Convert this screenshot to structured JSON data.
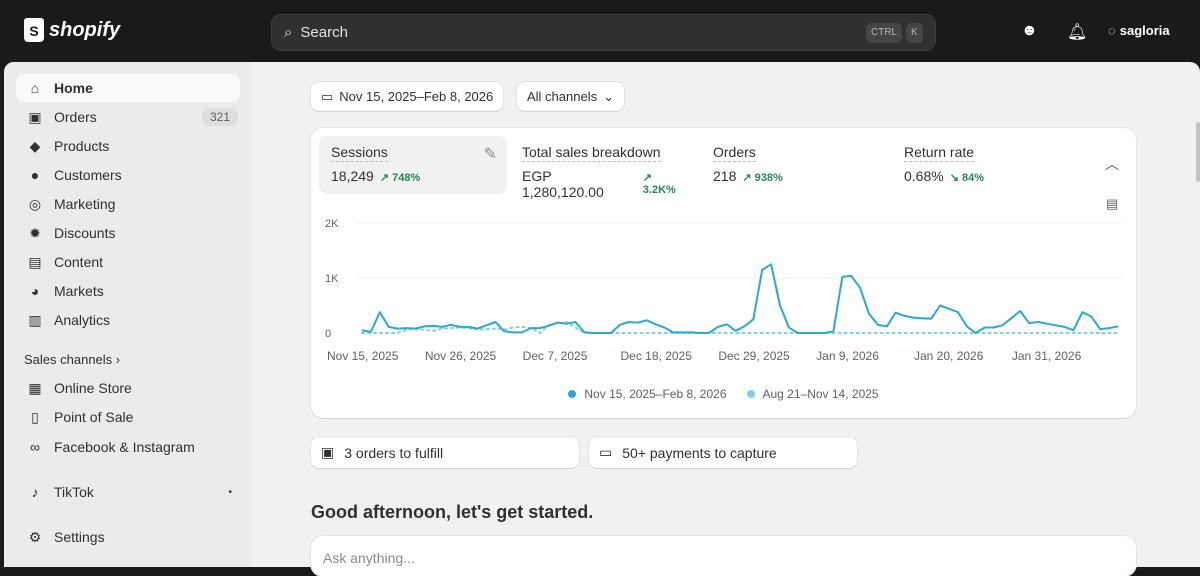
{
  "header": {
    "brand": "shopify",
    "search_placeholder": "Search",
    "kbd": [
      "CTRL",
      "K"
    ],
    "user": "sagloria"
  },
  "sidebar": {
    "items": [
      {
        "label": "Home",
        "icon": "home-icon",
        "glyph": "⌂"
      },
      {
        "label": "Orders",
        "icon": "inbox-icon",
        "glyph": "▣",
        "badge": "321"
      },
      {
        "label": "Products",
        "icon": "tag-icon",
        "glyph": "◆"
      },
      {
        "label": "Customers",
        "icon": "person-icon",
        "glyph": "●"
      },
      {
        "label": "Marketing",
        "icon": "target-icon",
        "glyph": "◎"
      },
      {
        "label": "Discounts",
        "icon": "discount-icon",
        "glyph": "✹"
      },
      {
        "label": "Content",
        "icon": "content-icon",
        "glyph": "▤"
      },
      {
        "label": "Markets",
        "icon": "globe-icon",
        "glyph": "◕"
      },
      {
        "label": "Analytics",
        "icon": "bar-chart-icon",
        "glyph": "▥"
      }
    ],
    "sales_channels_label": "Sales channels",
    "channels": [
      {
        "label": "Online Store",
        "icon": "store-icon",
        "glyph": "▦"
      },
      {
        "label": "Point of Sale",
        "icon": "pos-icon",
        "glyph": "▯"
      },
      {
        "label": "Facebook & Instagram",
        "icon": "meta-icon",
        "glyph": "∞"
      },
      {
        "label": "TikTok",
        "icon": "tiktok-icon",
        "glyph": "♪"
      }
    ],
    "settings_label": "Settings"
  },
  "filters": {
    "date_range": "Nov 15, 2025–Feb 8, 2026",
    "channel": "All channels"
  },
  "metrics": [
    {
      "label": "Sessions",
      "value": "18,249",
      "delta": "↗ 748%"
    },
    {
      "label": "Total sales breakdown",
      "value": "EGP 1,280,120.00",
      "delta": "↗ 3.2K%"
    },
    {
      "label": "Orders",
      "value": "218",
      "delta": "↗ 938%"
    },
    {
      "label": "Return rate",
      "value": "0.68%",
      "delta": "↘ 84%"
    }
  ],
  "chart_data": {
    "type": "line",
    "ylabels": [
      "0",
      "1K",
      "2K"
    ],
    "ylim": [
      0,
      2000
    ],
    "xlabels": [
      "Nov 15, 2025",
      "Nov 26, 2025",
      "Dec 7, 2025",
      "Dec 18, 2025",
      "Dec 29, 2025",
      "Jan 9, 2026",
      "Jan 20, 2026",
      "Jan 31, 2026"
    ],
    "series": [
      {
        "name": "Nov 15, 2025–Feb 8, 2026",
        "color": "#2ea7d4",
        "values": [
          50,
          20,
          380,
          110,
          80,
          90,
          80,
          120,
          130,
          110,
          150,
          110,
          110,
          80,
          140,
          200,
          30,
          10,
          10,
          90,
          90,
          130,
          190,
          170,
          200,
          10,
          0,
          0,
          0,
          150,
          200,
          190,
          230,
          160,
          100,
          10,
          10,
          10,
          0,
          0,
          110,
          160,
          40,
          120,
          250,
          1150,
          1250,
          500,
          100,
          0,
          0,
          0,
          0,
          30,
          1020,
          1040,
          820,
          350,
          150,
          120,
          370,
          310,
          280,
          270,
          260,
          500,
          440,
          380,
          120,
          0,
          100,
          100,
          140,
          270,
          400,
          180,
          200,
          170,
          140,
          110,
          50,
          380,
          300,
          70,
          90,
          120
        ]
      },
      {
        "name": "Aug 21–Nov 14, 2025",
        "color": "#7fcde6",
        "values": [
          0,
          0,
          0,
          0,
          0,
          60,
          70,
          60,
          40,
          80,
          90,
          100,
          90,
          60,
          70,
          80,
          60,
          100,
          110,
          90,
          0,
          150,
          180,
          200,
          100,
          0,
          0,
          0,
          0,
          0,
          0,
          0,
          0,
          0,
          0,
          0,
          0,
          0,
          0,
          0,
          0,
          0,
          0,
          0,
          0,
          0,
          0,
          0,
          0,
          0,
          0,
          0,
          0,
          0,
          0,
          0,
          0,
          0,
          0,
          0,
          0,
          0,
          0,
          0,
          0,
          0,
          0,
          0,
          0,
          0,
          0,
          0,
          0,
          0,
          0,
          0,
          0,
          0,
          0,
          0,
          0,
          0,
          0,
          0,
          0,
          0
        ]
      }
    ]
  },
  "alerts": {
    "fulfill": "3 orders to fulfill",
    "payments": "50+ payments to capture"
  },
  "greeting": "Good afternoon, let's get started.",
  "ask_placeholder": "Ask anything..."
}
